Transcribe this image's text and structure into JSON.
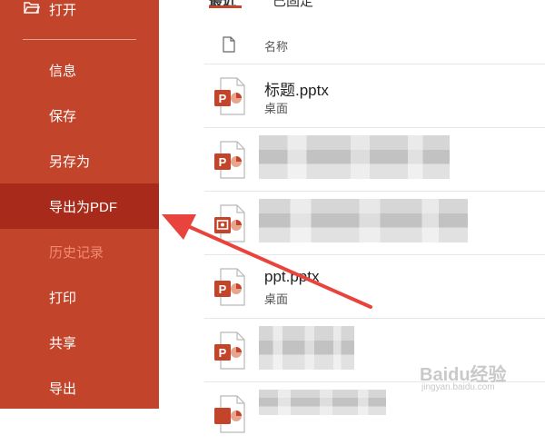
{
  "sidebar": {
    "open_label": "打开",
    "items": [
      {
        "label": "信息"
      },
      {
        "label": "保存"
      },
      {
        "label": "另存为"
      },
      {
        "label": "导出为PDF"
      },
      {
        "label": "历史记录"
      },
      {
        "label": "打印"
      },
      {
        "label": "共享"
      },
      {
        "label": "导出"
      }
    ]
  },
  "tabs": [
    {
      "label": "最近"
    },
    {
      "label": "已固定"
    }
  ],
  "list": {
    "header_name": "名称",
    "rows": [
      {
        "name": "标题.pptx",
        "location": "桌面"
      },
      {
        "name": "",
        "location": ""
      },
      {
        "name": "",
        "location": ""
      },
      {
        "name": "ppt.pptx",
        "location": "桌面"
      },
      {
        "name": "",
        "location": ""
      },
      {
        "name": "",
        "location": ""
      }
    ]
  },
  "watermark": {
    "logo": "Baidu经验",
    "sub": "jingyan.baidu.com"
  },
  "colors": {
    "accent": "#c2442a",
    "active": "#a82a1a",
    "disabled_text": "#f08a72",
    "arrow": "#e8433c"
  }
}
